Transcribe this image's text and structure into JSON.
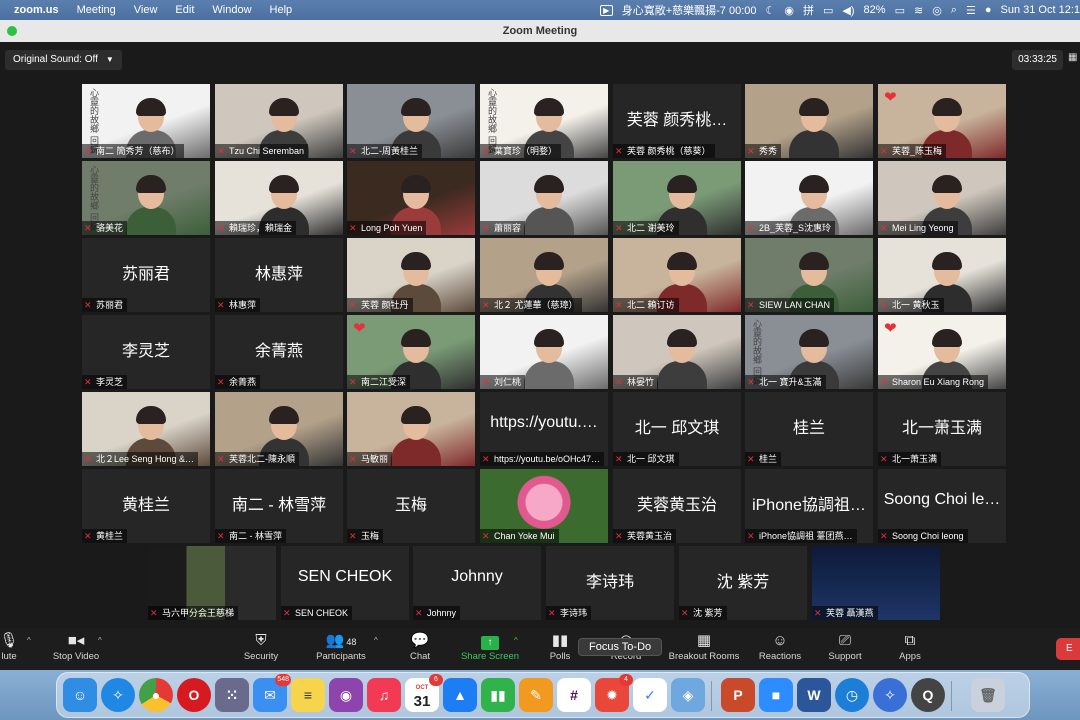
{
  "menubar": {
    "app": "zoom.us",
    "items": [
      "Meeting",
      "View",
      "Edit",
      "Window",
      "Help"
    ],
    "meeting_status": "身心寬敞+慈樂飄揚-7 00:00",
    "battery": "82%",
    "clock": "Sun 31 Oct  12:1"
  },
  "window": {
    "title": "Zoom Meeting"
  },
  "meeting": {
    "original_sound": "Original Sound: Off",
    "timer": "03:33:25"
  },
  "tiles": [
    {
      "label": "南二 簡秀芳（慈布）",
      "big": "",
      "video": true
    },
    {
      "label": "Tzu Chi Seremban",
      "big": "",
      "video": true
    },
    {
      "label": "北二-周黃桂兰",
      "big": "",
      "video": true
    },
    {
      "label": "葉寶珍（明婺）",
      "big": "",
      "video": true
    },
    {
      "label": "芙蓉 颜秀桃（慈葵）",
      "big": "芙蓉 颜秀桃…",
      "video": false
    },
    {
      "label": "秀秀",
      "big": "",
      "video": true
    },
    {
      "label": "芙蓉_陈玉梅",
      "big": "",
      "video": true
    },
    {
      "label": "骆美花",
      "big": "",
      "video": true
    },
    {
      "label": "賴瑞珍，賴瑞金",
      "big": "",
      "video": true
    },
    {
      "label": "Long Poh Yuen",
      "big": "",
      "video": true
    },
    {
      "label": "蕭丽容",
      "big": "",
      "video": true
    },
    {
      "label": "北二 谢美玲",
      "big": "",
      "video": true
    },
    {
      "label": "2B_芙蓉_S沈惠玲",
      "big": "",
      "video": true
    },
    {
      "label": "Mei Ling Yeong",
      "big": "",
      "video": true
    },
    {
      "label": "苏丽君",
      "big": "苏丽君",
      "video": false
    },
    {
      "label": "林惠萍",
      "big": "林惠萍",
      "video": false
    },
    {
      "label": "芙蓉 颜牡丹",
      "big": "",
      "video": true
    },
    {
      "label": "北２ 尤蓮華（慈璋）",
      "big": "",
      "video": true
    },
    {
      "label": "北二 賴订访",
      "big": "",
      "video": true
    },
    {
      "label": "SIEW LAN CHAN",
      "big": "",
      "video": true
    },
    {
      "label": "北一 黄秋玉",
      "big": "",
      "video": true
    },
    {
      "label": "李灵芝",
      "big": "李灵芝",
      "video": false
    },
    {
      "label": "余菁燕",
      "big": "余菁燕",
      "video": false
    },
    {
      "label": "南二江受深",
      "big": "",
      "video": true
    },
    {
      "label": "刘仁桃",
      "big": "",
      "video": true
    },
    {
      "label": "林晏竹",
      "big": "",
      "video": true
    },
    {
      "label": "北一 寶升&玉滿",
      "big": "",
      "video": true
    },
    {
      "label": "Sharon Eu Xiang Rong",
      "big": "",
      "video": true
    },
    {
      "label": "北２Lee Seng Hong &…",
      "big": "",
      "video": true
    },
    {
      "label": "芙蓉北二-陳永順",
      "big": "",
      "video": true
    },
    {
      "label": "马敏丽",
      "big": "",
      "video": true
    },
    {
      "label": "https://youtu.be/oOHc47…",
      "big": "https://youtu.…",
      "video": false
    },
    {
      "label": "北一 邱文琪",
      "big": "北一 邱文琪",
      "video": false
    },
    {
      "label": "桂兰",
      "big": "桂兰",
      "video": false
    },
    {
      "label": "北一萧玉满",
      "big": "北一萧玉满",
      "video": false
    },
    {
      "label": "黄桂兰",
      "big": "黄桂兰",
      "video": false
    },
    {
      "label": "南二 - 林雪萍",
      "big": "南二 - 林雪萍",
      "video": false
    },
    {
      "label": "玉梅",
      "big": "玉梅",
      "video": false
    },
    {
      "label": "Chan Yoke Mui",
      "big": "",
      "video": true
    },
    {
      "label": "芙蓉黄玉治",
      "big": "芙蓉黄玉治",
      "video": false
    },
    {
      "label": "iPhone協調祖 薹团燕…",
      "big": "iPhone協調祖…",
      "video": false
    },
    {
      "label": "Soong Choi leong",
      "big": "Soong Choi le…",
      "video": false
    },
    {
      "label": "马六甲分会王慈梯",
      "big": "",
      "video": true
    },
    {
      "label": "SEN CHEOK",
      "big": "SEN CHEOK",
      "video": false
    },
    {
      "label": "Johnny",
      "big": "Johnny",
      "video": false
    },
    {
      "label": "李诗玮",
      "big": "李诗玮",
      "video": false
    },
    {
      "label": "沈 紫芳",
      "big": "沈 紫芳",
      "video": false
    },
    {
      "label": "芙蓉 聶漢燕",
      "big": "",
      "video": true
    }
  ],
  "calligraphy": "心靈的故鄉 回歸",
  "toolbar": {
    "mute": "lute",
    "stop_video": "Stop Video",
    "security": "Security",
    "participants": "Participants",
    "participants_count": "48",
    "chat": "Chat",
    "share_screen": "Share Screen",
    "polls": "Polls",
    "record": "Record",
    "breakout": "Breakout Rooms",
    "reactions": "Reactions",
    "support": "Support",
    "apps": "Apps",
    "end": "E",
    "tooltip": "Focus To-Do"
  },
  "dock": {
    "mail_badge": "548",
    "calendar_month": "OCT",
    "calendar_day": "31",
    "calendar_badge": "6",
    "todo_badge": "4"
  },
  "colors": {
    "active_speaker": "#b5d337",
    "share_green": "#27b24a",
    "end_red": "#d93a3a",
    "mute_red": "#e0303a"
  }
}
